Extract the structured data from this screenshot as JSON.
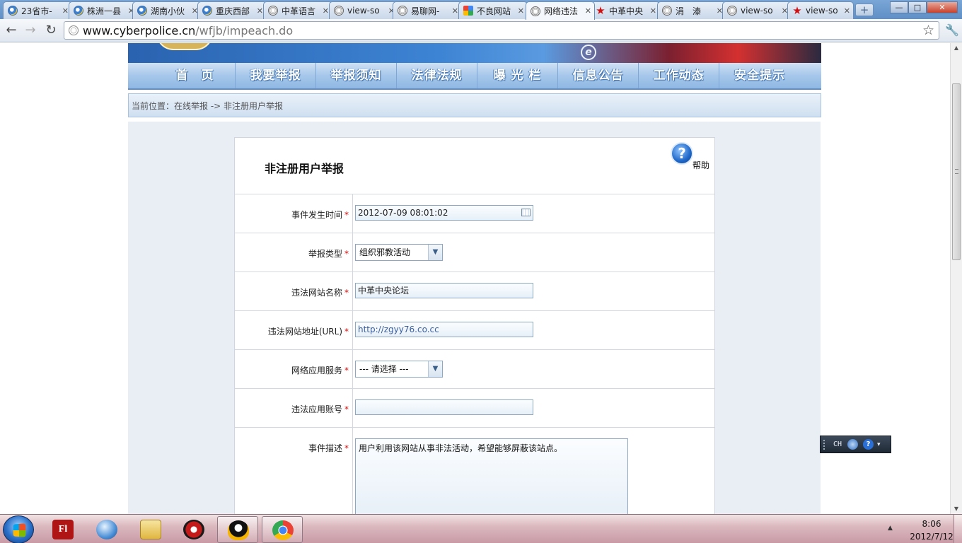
{
  "browser": {
    "tabs": [
      {
        "label": "23省市-",
        "icon": "ie",
        "active": false
      },
      {
        "label": "株洲一县",
        "icon": "ie",
        "active": false
      },
      {
        "label": "湖南小伙",
        "icon": "ie",
        "active": false
      },
      {
        "label": "重庆西部",
        "icon": "ie",
        "active": false
      },
      {
        "label": "中革语言",
        "icon": "globe",
        "active": false
      },
      {
        "label": "view-so",
        "icon": "globe",
        "active": false
      },
      {
        "label": "易聊网-",
        "icon": "globe",
        "active": false
      },
      {
        "label": "不良网站",
        "icon": "g",
        "active": false
      },
      {
        "label": "网络违法",
        "icon": "globe",
        "active": true
      },
      {
        "label": "中革中央",
        "icon": "star",
        "active": false
      },
      {
        "label": "涓　溙",
        "icon": "globe",
        "active": false
      },
      {
        "label": "view-so",
        "icon": "globe",
        "active": false
      },
      {
        "label": "view-so",
        "icon": "star",
        "active": false
      }
    ],
    "new_tab_label": "+",
    "window_buttons": {
      "minimize": "—",
      "maximize": "□",
      "close": "✕"
    },
    "url_domain": "www.cyberpolice.cn",
    "url_path": "/wfjb/impeach.do"
  },
  "site": {
    "nav": [
      "首　页",
      "我要举报",
      "举报须知",
      "法律法规",
      "曝 光 栏",
      "信息公告",
      "工作动态",
      "安全提示"
    ],
    "breadcrumb": "当前位置：在线举报 -> 非注册用户举报",
    "banner_logo": "e"
  },
  "form": {
    "title": "非注册用户举报",
    "help_icon": "?",
    "help_label": "帮助",
    "required_mark": "*",
    "fields": {
      "time": {
        "label": "事件发生时间",
        "value": "2012-07-09 08:01:02"
      },
      "type": {
        "label": "举报类型",
        "value": "组织邪教活动"
      },
      "site_name": {
        "label": "违法网站名称",
        "value": "中革中央论坛"
      },
      "site_url": {
        "label": "违法网站地址(URL)",
        "value": "http://zgyy76.co.cc"
      },
      "service": {
        "label": "网络应用服务",
        "value": "--- 请选择 ---"
      },
      "account": {
        "label": "违法应用账号",
        "value": ""
      },
      "description": {
        "label": "事件描述",
        "value": "用户利用该网站从事非法活动，希望能够屏蔽该站点。"
      }
    }
  },
  "ime": {
    "lang": "CH",
    "help": "?"
  },
  "taskbar": {
    "flash_label": "Fl",
    "clock_time": "8:06",
    "clock_date": "2012/7/12"
  }
}
